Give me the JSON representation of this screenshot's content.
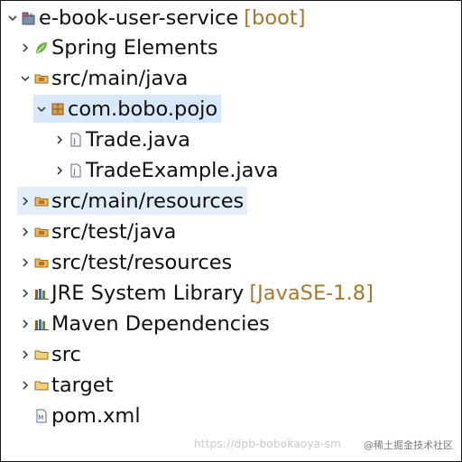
{
  "project": {
    "name": "e-book-user-service",
    "decoration": "[boot]"
  },
  "items": [
    {
      "label": "Spring Elements"
    },
    {
      "label": "src/main/java"
    },
    {
      "label": "com.bobo.pojo"
    },
    {
      "label": "Trade.java"
    },
    {
      "label": "TradeExample.java"
    },
    {
      "label": "src/main/resources"
    },
    {
      "label": "src/test/java"
    },
    {
      "label": "src/test/resources"
    },
    {
      "label": "JRE System Library",
      "decoration": "[JavaSE-1.8]"
    },
    {
      "label": "Maven Dependencies"
    },
    {
      "label": "src"
    },
    {
      "label": "target"
    },
    {
      "label": "pom.xml"
    }
  ],
  "icons": {
    "project": "maven-project-icon",
    "spring": "spring-leaf-icon",
    "source_folder": "source-folder-icon",
    "package": "package-icon",
    "java_file": "java-file-icon",
    "library": "library-icon",
    "folder": "folder-icon",
    "xml_file": "xml-file-icon"
  },
  "colors": {
    "selection": "#d9e8fb",
    "decoration": "#a07a34",
    "package": "#b8742a",
    "spring": "#6db33f"
  },
  "watermark": {
    "url": "https://dpb-bobokaoya-sm",
    "site": "@稀土掘金技术社区"
  }
}
